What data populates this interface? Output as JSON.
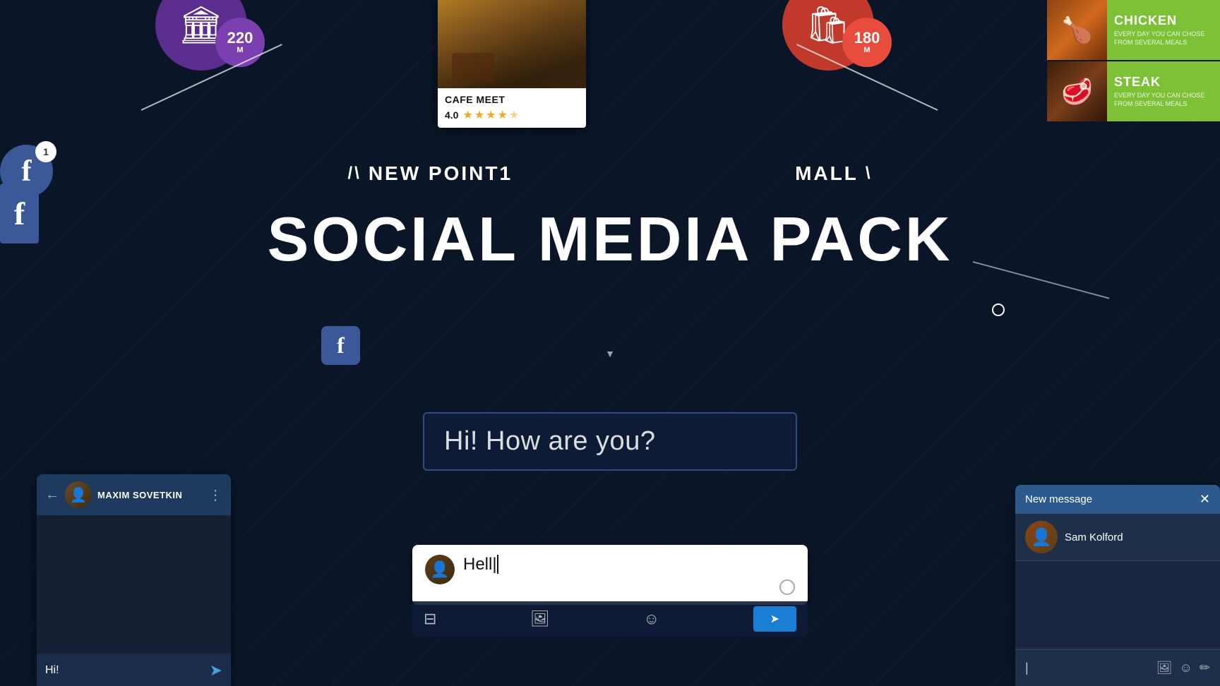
{
  "app": {
    "title": "Social Media Pack",
    "background_color": "#0a1628"
  },
  "top_left": {
    "icon": "🏛",
    "badge_number": "220",
    "badge_unit": "M"
  },
  "cafe_card": {
    "name": "CAFE MEET",
    "rating_score": "4.0",
    "stars": [
      true,
      true,
      true,
      true,
      false
    ],
    "image_alt": "Cafe interior"
  },
  "top_right": {
    "icon": "🛍",
    "badge_number": "180",
    "badge_unit": "M"
  },
  "food_items": [
    {
      "name": "CHICKEN",
      "description": "EVERY DAY YOU CAN CHOSE FROM SEVERAL MEALS"
    },
    {
      "name": "STEAK",
      "description": "EVERY DAY YOU CAN CHOSE FROM SEVERAL MEALS"
    }
  ],
  "labels": {
    "left": "NEW POINT1",
    "right": "MALL"
  },
  "main_title": "SOCIAL MEDIA PACK",
  "facebook_left": {
    "letter": "f",
    "badge": "1"
  },
  "speech_bubble": {
    "text": "Hi! How are you?"
  },
  "chat_panel": {
    "username": "MAXIM SOVETKIN",
    "footer_text": "Hi!",
    "send_label": "➤"
  },
  "message_input": {
    "typed_text": "Hell",
    "cursor": "|"
  },
  "new_message_panel": {
    "title": "New message",
    "close": "✕",
    "recipient": "Sam Kolford",
    "input_placeholder": "|"
  }
}
